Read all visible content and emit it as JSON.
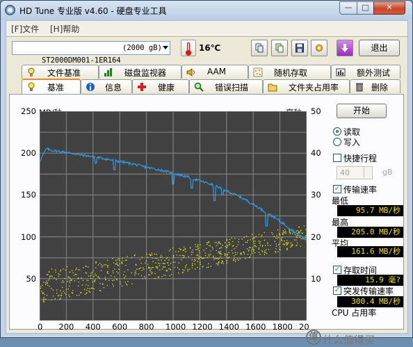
{
  "window": {
    "title": "HD Tune 专业版 v4.60 - 硬盘专业工具",
    "minimize": "—",
    "maximize": "□",
    "close": "✕"
  },
  "menu": {
    "file": "[F]文件",
    "help": "[H]帮助"
  },
  "toolbar": {
    "drive": "ST2000DM001-1ER164",
    "drive_size": "(2000 gB)",
    "temperature": "16℃",
    "exit": "退出"
  },
  "tabs_row1": [
    {
      "label": "文件基准",
      "icon": "file-benchmark-icon"
    },
    {
      "label": "磁盘监视器",
      "icon": "disk-monitor-icon"
    },
    {
      "label": "AAM",
      "icon": "speaker-icon"
    },
    {
      "label": "随机存取",
      "icon": "random-access-icon"
    },
    {
      "label": "额外测试",
      "icon": "extra-tests-icon"
    }
  ],
  "tabs_row2": [
    {
      "label": "基准",
      "icon": "lightbulb-icon",
      "active": true
    },
    {
      "label": "信息",
      "icon": "info-icon"
    },
    {
      "label": "健康",
      "icon": "health-cross-icon"
    },
    {
      "label": "错误扫描",
      "icon": "magnifier-icon"
    },
    {
      "label": "文件夹占用率",
      "icon": "folder-icon"
    },
    {
      "label": "删除",
      "icon": "trash-icon"
    }
  ],
  "side": {
    "start": "开始",
    "read": "读取",
    "write": "写入",
    "short_stroke": "快捷行程",
    "short_stroke_value": "40",
    "short_stroke_unit": "gB",
    "transfer_rate": "传输速率",
    "min_label": "最低",
    "min_value": "95.7 MB/秒",
    "max_label": "最高",
    "max_value": "205.0 MB/秒",
    "avg_label": "平均",
    "avg_value": "161.6 MB/秒",
    "access_time": "存取时间",
    "access_value": "15.9 毫?",
    "burst_rate": "突发传输速率",
    "burst_value": "300.4 MB/秒",
    "cpu_usage": "CPU 占用率"
  },
  "watermark": "什么值得买",
  "chart_data": {
    "type": "line",
    "xlabel": "",
    "ylabel": "MB/秒",
    "y2label": "毫秒",
    "xlim": [
      0,
      2000
    ],
    "ylim": [
      0,
      250
    ],
    "y2lim": [
      0,
      50
    ],
    "x_ticks": [
      "0",
      "200",
      "400",
      "600",
      "800",
      "1000",
      "1200",
      "1400",
      "1600",
      "1800",
      "20"
    ],
    "y_ticks": [
      "250",
      "200",
      "150",
      "100",
      "50"
    ],
    "y2_ticks": [
      "50",
      "40",
      "30",
      "20",
      "10"
    ],
    "grid": true,
    "series": [
      {
        "kind": "line",
        "color": "#2e9be6",
        "x": [
          0,
          50,
          100,
          200,
          300,
          400,
          500,
          600,
          700,
          800,
          900,
          1000,
          1100,
          1200,
          1300,
          1400,
          1500,
          1600,
          1700,
          1800,
          1900,
          2000
        ],
        "y": [
          190,
          205,
          203,
          201,
          198,
          196,
          193,
          190,
          187,
          183,
          180,
          176,
          172,
          167,
          162,
          155,
          148,
          139,
          129,
          119,
          107,
          96
        ],
        "dips": [
          [
            420,
            188
          ],
          [
            560,
            180
          ],
          [
            1000,
            163
          ],
          [
            1140,
            158
          ],
          [
            1310,
            143
          ],
          [
            1370,
            150
          ],
          [
            1700,
            113
          ]
        ]
      },
      {
        "kind": "scatter",
        "color": "#e8e81c",
        "band_x": [
          0,
          2000
        ],
        "band_ms_low": [
          4,
          18
        ],
        "band_ms_high": [
          12,
          23
        ],
        "points": 700
      }
    ]
  }
}
